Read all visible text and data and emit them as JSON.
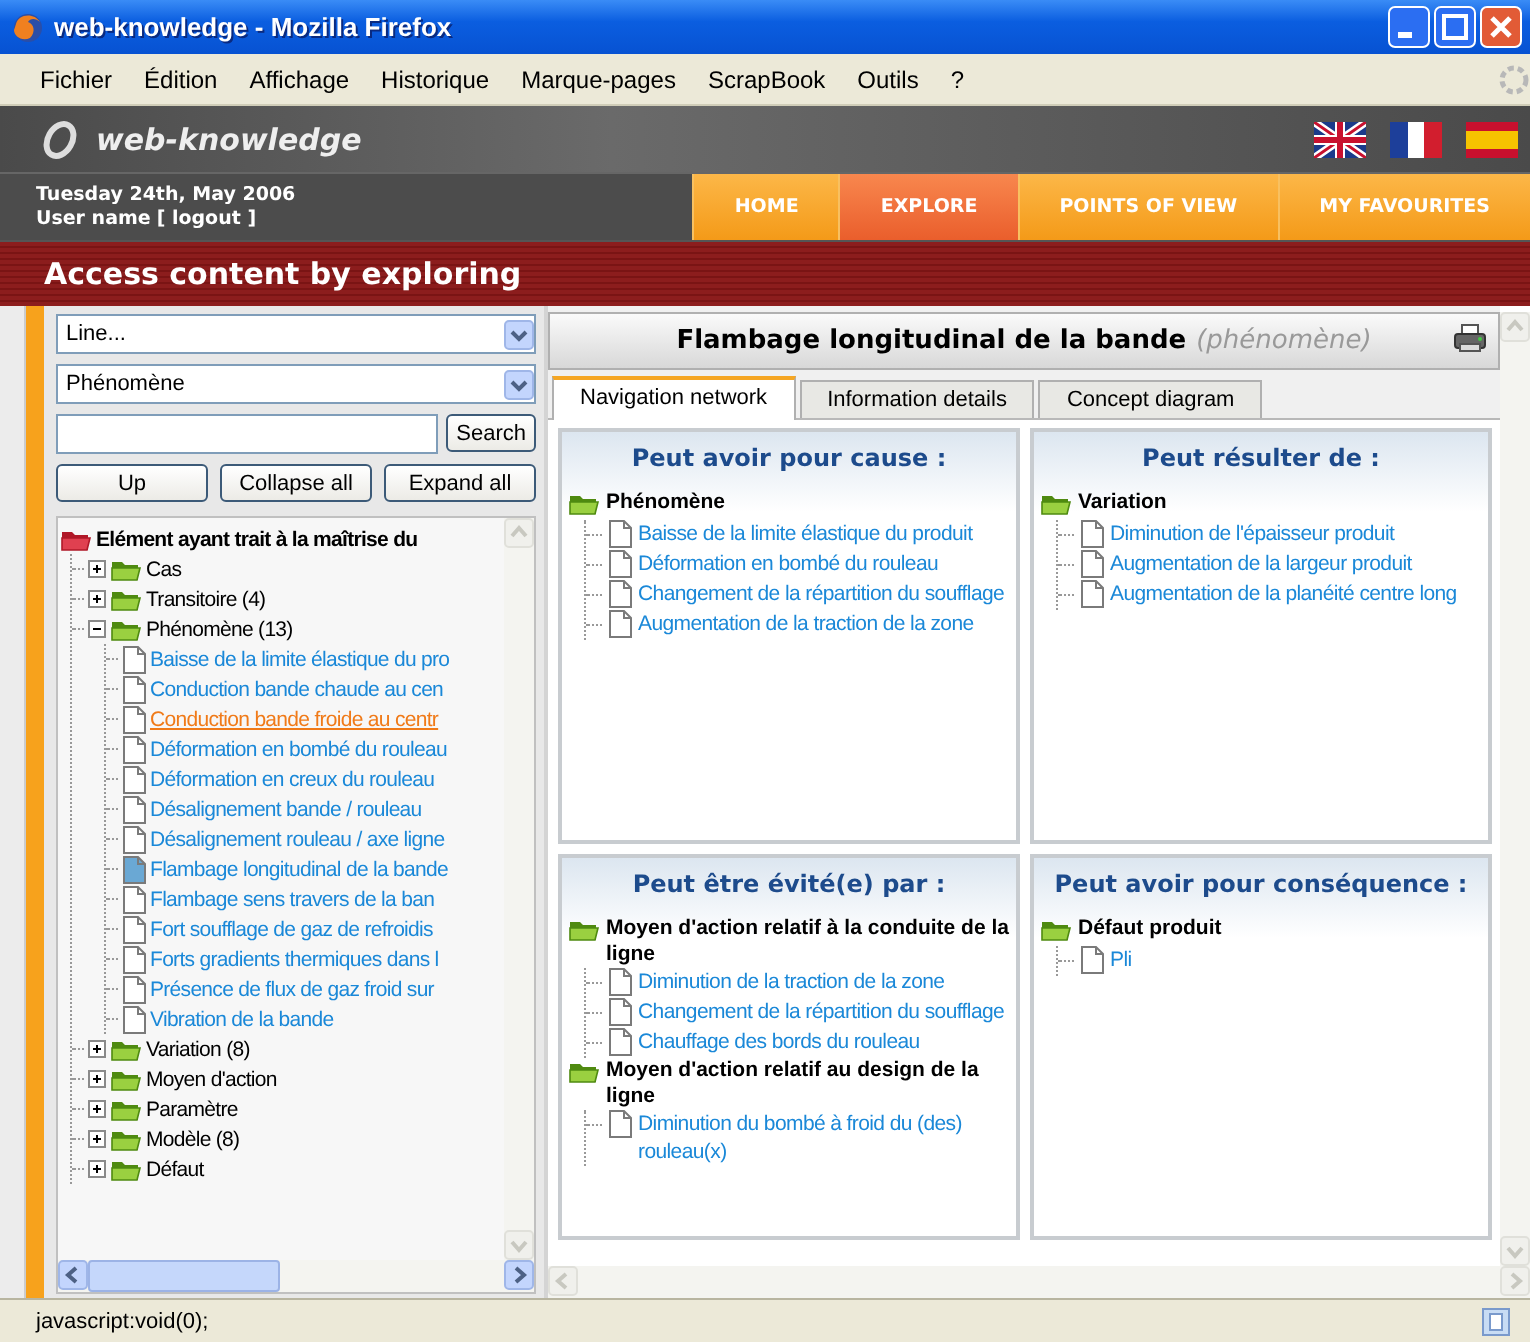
{
  "window": {
    "title": "web-knowledge - Mozilla Firefox"
  },
  "menu": [
    "Fichier",
    "Édition",
    "Affichage",
    "Historique",
    "Marque-pages",
    "ScrapBook",
    "Outils",
    "?"
  ],
  "site": {
    "logo": "web-knowledge",
    "date": "Tuesday 24th, May 2006",
    "user": "User name",
    "logout": "[ logout ]",
    "nav": [
      {
        "label": "HOME",
        "selected": false
      },
      {
        "label": "EXPLORE",
        "selected": true
      },
      {
        "label": "POINTS OF VIEW",
        "selected": false
      },
      {
        "label": "MY FAVOURITES",
        "selected": false
      }
    ],
    "banner": "Access content by exploring"
  },
  "explorer": {
    "selects": [
      "Line...",
      "Phénomène"
    ],
    "search_button": "Search",
    "buttons": [
      "Up",
      "Collapse all",
      "Expand all"
    ],
    "tree": {
      "kind": "root",
      "label": "Elément ayant trait à la maîtrise du",
      "children": [
        {
          "kind": "folder",
          "label": "Cas",
          "expanded": false
        },
        {
          "kind": "folder",
          "label": "Transitoire (4)",
          "expanded": false
        },
        {
          "kind": "folder",
          "label": "Phénomène (13)",
          "expanded": true,
          "children": [
            {
              "kind": "document",
              "label": "Baisse de la limite élastique du pro",
              "selected": false,
              "hovered": false
            },
            {
              "kind": "document",
              "label": "Conduction bande chaude au cen",
              "selected": false,
              "hovered": false
            },
            {
              "kind": "document",
              "label": "Conduction bande froide au centr",
              "selected": false,
              "hovered": true
            },
            {
              "kind": "document",
              "label": "Déformation en bombé du rouleau",
              "selected": false,
              "hovered": false
            },
            {
              "kind": "document",
              "label": "Déformation en creux du rouleau",
              "selected": false,
              "hovered": false
            },
            {
              "kind": "document",
              "label": "Désalignement bande / rouleau",
              "selected": false,
              "hovered": false
            },
            {
              "kind": "document",
              "label": "Désalignement rouleau / axe ligne",
              "selected": false,
              "hovered": false
            },
            {
              "kind": "document",
              "label": "Flambage longitudinal de la bande",
              "selected": true,
              "hovered": false
            },
            {
              "kind": "document",
              "label": "Flambage sens travers de la ban",
              "selected": false,
              "hovered": false
            },
            {
              "kind": "document",
              "label": "Fort soufflage de gaz de refroidis",
              "selected": false,
              "hovered": false
            },
            {
              "kind": "document",
              "label": "Forts gradients thermiques dans l",
              "selected": false,
              "hovered": false
            },
            {
              "kind": "document",
              "label": "Présence de flux de gaz froid sur",
              "selected": false,
              "hovered": false
            },
            {
              "kind": "document",
              "label": "Vibration de la bande",
              "selected": false,
              "hovered": false
            }
          ]
        },
        {
          "kind": "folder",
          "label": "Variation (8)",
          "expanded": false
        },
        {
          "kind": "folder",
          "label": "Moyen d'action",
          "expanded": false
        },
        {
          "kind": "folder",
          "label": "Paramètre",
          "expanded": false
        },
        {
          "kind": "folder",
          "label": "Modèle (8)",
          "expanded": false
        },
        {
          "kind": "folder",
          "label": "Défaut",
          "expanded": false
        }
      ]
    }
  },
  "concept": {
    "title": "Flambage longitudinal de la bande",
    "type": "(phénomène)",
    "tabs": [
      {
        "label": "Navigation network",
        "selected": true
      },
      {
        "label": "Information details",
        "selected": false
      },
      {
        "label": "Concept diagram",
        "selected": false
      }
    ],
    "panels": [
      {
        "title": "Peut avoir pour cause :",
        "groups": [
          {
            "label": "Phénomène",
            "items": [
              "Baisse de la limite élastique du produit",
              "Déformation en bombé du rouleau",
              "Changement de la répartition du soufflage",
              "Augmentation de la traction de la zone"
            ]
          }
        ]
      },
      {
        "title": "Peut résulter de :",
        "groups": [
          {
            "label": "Variation",
            "items": [
              "Diminution de l'épaisseur produit",
              "Augmentation de la largeur produit",
              "Augmentation de la planéité centre long"
            ]
          }
        ]
      },
      {
        "title": "Peut être évité(e) par :",
        "groups": [
          {
            "label": "Moyen d'action relatif à la conduite de la ligne",
            "items": [
              "Diminution de la traction de la zone",
              "Changement de la répartition du soufflage",
              "Chauffage des bords du rouleau"
            ]
          },
          {
            "label": "Moyen d'action relatif au design de la ligne",
            "items": [
              "Diminution du bombé à froid du (des) rouleau(x)"
            ]
          }
        ]
      },
      {
        "title": "Peut avoir pour conséquence :",
        "groups": [
          {
            "label": "Défaut produit",
            "items": [
              "Pli"
            ]
          }
        ]
      }
    ]
  },
  "status_bar": "javascript:void(0);"
}
